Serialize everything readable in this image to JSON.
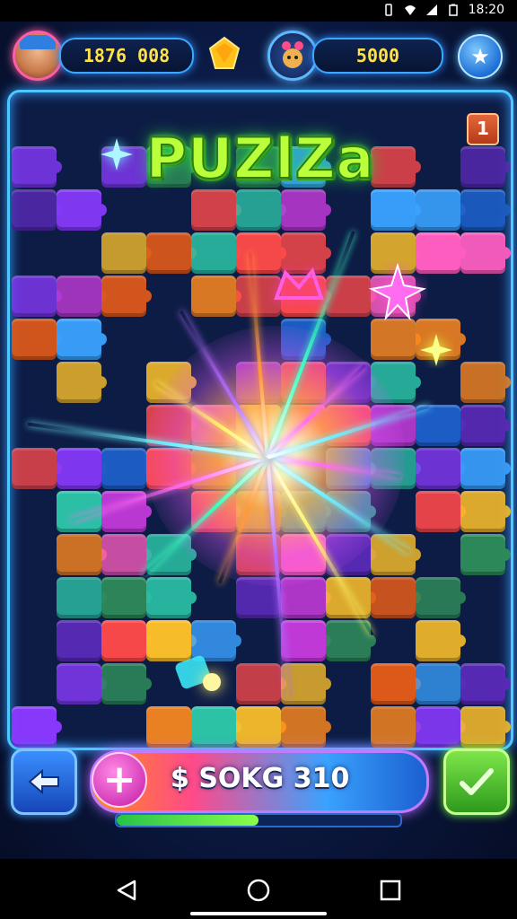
{
  "status_bar": {
    "time": "18:20"
  },
  "hud": {
    "coins": "1876 008",
    "gems": "5000"
  },
  "game": {
    "title": "PUZlZa",
    "level_badge": "1"
  },
  "footer": {
    "score_text": "$ SOKG 310",
    "progress": 0.5
  },
  "colors": {
    "accent_glow": "#4fc7ff",
    "title_green": "#b9ff3a",
    "coin_yellow": "#ffe14a"
  }
}
